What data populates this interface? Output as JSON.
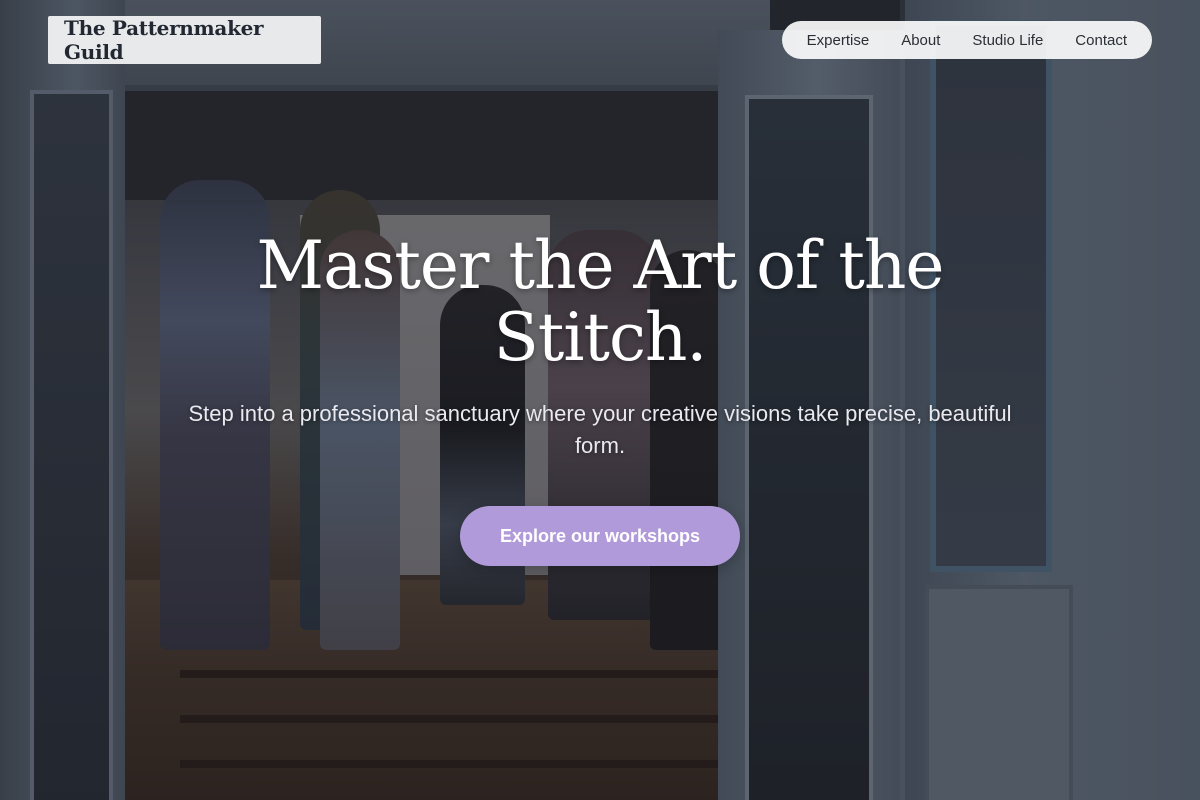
{
  "header": {
    "logo_text": "The Patternmaker Guild",
    "nav": [
      {
        "label": "Expertise"
      },
      {
        "label": "About"
      },
      {
        "label": "Studio Life"
      },
      {
        "label": "Contact"
      }
    ]
  },
  "hero": {
    "title": "Master the Art of the Stitch.",
    "subtitle": "Step into a professional sanctuary where your creative visions take precise, beautiful form.",
    "cta_label": "Explore our workshops"
  },
  "colors": {
    "accent": "#b19ad9",
    "nav_background": "#ffffff",
    "text_dark": "#222831"
  }
}
